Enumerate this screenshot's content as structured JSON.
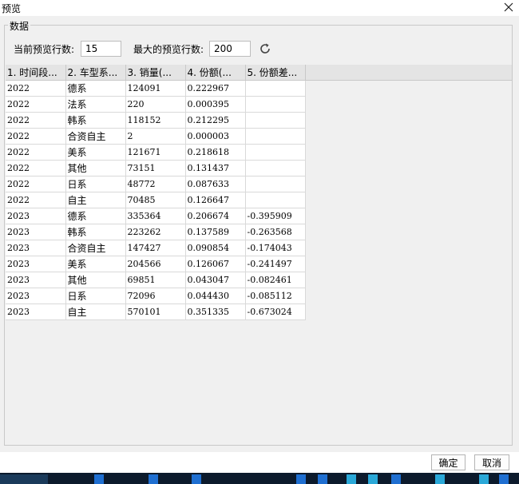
{
  "window": {
    "title": "预览"
  },
  "group": {
    "title": "数据"
  },
  "params": {
    "current_rows_label": "当前预览行数:",
    "current_rows_value": "15",
    "max_rows_label": "最大的预览行数:",
    "max_rows_value": "200"
  },
  "table": {
    "headers": [
      "1. 时间段...",
      "2. 车型系...",
      "3. 销量(...",
      "4. 份额(...",
      "5. 份额差..."
    ],
    "rows": [
      [
        "2022",
        "德系",
        "124091",
        "0.222967",
        ""
      ],
      [
        "2022",
        "法系",
        "220",
        "0.000395",
        ""
      ],
      [
        "2022",
        "韩系",
        "118152",
        "0.212295",
        ""
      ],
      [
        "2022",
        "合资自主",
        "2",
        "0.000003",
        ""
      ],
      [
        "2022",
        "美系",
        "121671",
        "0.218618",
        ""
      ],
      [
        "2022",
        "其他",
        "73151",
        "0.131437",
        ""
      ],
      [
        "2022",
        "日系",
        "48772",
        "0.087633",
        ""
      ],
      [
        "2022",
        "自主",
        "70485",
        "0.126647",
        ""
      ],
      [
        "2023",
        "德系",
        "335364",
        "0.206674",
        "-0.395909"
      ],
      [
        "2023",
        "韩系",
        "223262",
        "0.137589",
        "-0.263568"
      ],
      [
        "2023",
        "合资自主",
        "147427",
        "0.090854",
        "-0.174043"
      ],
      [
        "2023",
        "美系",
        "204566",
        "0.126067",
        "-0.241497"
      ],
      [
        "2023",
        "其他",
        "69851",
        "0.043047",
        "-0.082461"
      ],
      [
        "2023",
        "日系",
        "72096",
        "0.044430",
        "-0.085112"
      ],
      [
        "2023",
        "自主",
        "570101",
        "0.351335",
        "-0.673024"
      ]
    ]
  },
  "buttons": {
    "ok": "确定",
    "cancel": "取消"
  },
  "icons": {
    "close": "close-icon",
    "refresh": "refresh-icon"
  },
  "colors": {
    "accent": "#1f6fd1",
    "taskbar": "#0c1a2c"
  }
}
